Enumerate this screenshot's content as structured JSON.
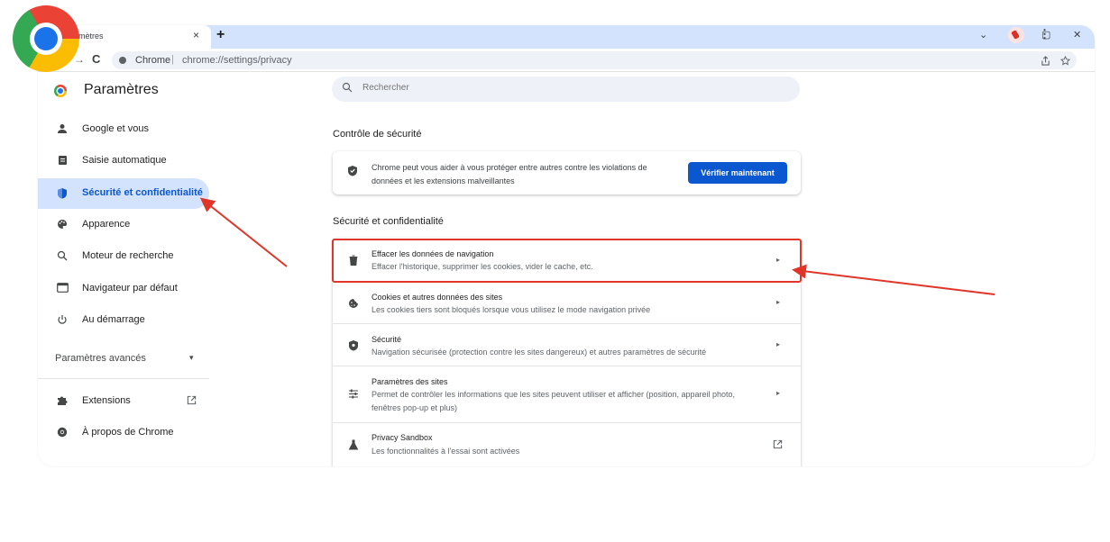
{
  "browser": {
    "tab_title": "Paramètres",
    "tab_title_visible": "amètres",
    "tab_close": "×",
    "new_tab": "+",
    "window_controls": [
      "⌄",
      "—",
      "▢",
      "✕"
    ],
    "back": "→",
    "reload": "C",
    "url_site": "Chrome",
    "url_separator": "|",
    "url_path": "chrome://settings/privacy",
    "toolbar_icons": [
      "share-icon",
      "star-icon",
      "profile-avatar",
      "menu-icon"
    ],
    "menu_glyph": "⋮"
  },
  "sidebar": {
    "title": "Paramètres",
    "items": [
      {
        "label": "Google et vous",
        "icon": "person-icon",
        "glyph": "👤"
      },
      {
        "label": "Saisie automatique",
        "icon": "clipboard-icon",
        "glyph": "▤"
      },
      {
        "label": "Sécurité et confidentialité",
        "icon": "shield-icon",
        "glyph": "⛉",
        "active": true
      },
      {
        "label": "Apparence",
        "icon": "palette-icon",
        "glyph": "✿"
      },
      {
        "label": "Moteur de recherche",
        "icon": "search-icon",
        "glyph": "⌕"
      },
      {
        "label": "Navigateur par défaut",
        "icon": "browser-icon",
        "glyph": "▭"
      },
      {
        "label": "Au démarrage",
        "icon": "power-icon",
        "glyph": "⏻"
      }
    ],
    "advanced_label": "Paramètres avancés",
    "advanced_caret": "▾",
    "extensions_label": "Extensions",
    "extensions_open_glyph": "↗",
    "about_label": "À propos de Chrome"
  },
  "search": {
    "placeholder": "Rechercher"
  },
  "safety_check": {
    "section_title": "Contrôle de sécurité",
    "text": "Chrome peut vous aider à vous protéger entre autres contre les violations de données et les extensions malveillantes",
    "button_label": "Vérifier maintenant"
  },
  "privacy": {
    "section_title": "Sécurité et confidentialité",
    "rows": [
      {
        "title": "Effacer les données de navigation",
        "desc": "Effacer l'historique, supprimer les cookies, vider le cache, etc.",
        "icon": "trash-icon",
        "glyph": "🗑"
      },
      {
        "title": "Cookies et autres données des sites",
        "desc": "Les cookies tiers sont bloqués lorsque vous utilisez le mode navigation privée",
        "icon": "cookie-icon",
        "glyph": "◉"
      },
      {
        "title": "Sécurité",
        "desc": "Navigation sécurisée (protection contre les sites dangereux) et autres paramètres de sécurité",
        "icon": "security-shield-icon",
        "glyph": "⛉"
      },
      {
        "title": "Paramètres des sites",
        "desc": "Permet de contrôler les informations que les sites peuvent utiliser et afficher (position, appareil photo, fenêtres pop-up et plus)",
        "icon": "sliders-icon",
        "glyph": "☷"
      },
      {
        "title": "Privacy Sandbox",
        "desc": "Les fonctionnalités à l'essai sont activées",
        "icon": "flask-icon",
        "glyph": "⏳"
      }
    ],
    "arrow_glyph": "▸",
    "external_glyph": "↗"
  },
  "colors": {
    "accent": "#0b57d0",
    "active_bg": "#d3e3fd",
    "annotation": "#e0362a"
  }
}
